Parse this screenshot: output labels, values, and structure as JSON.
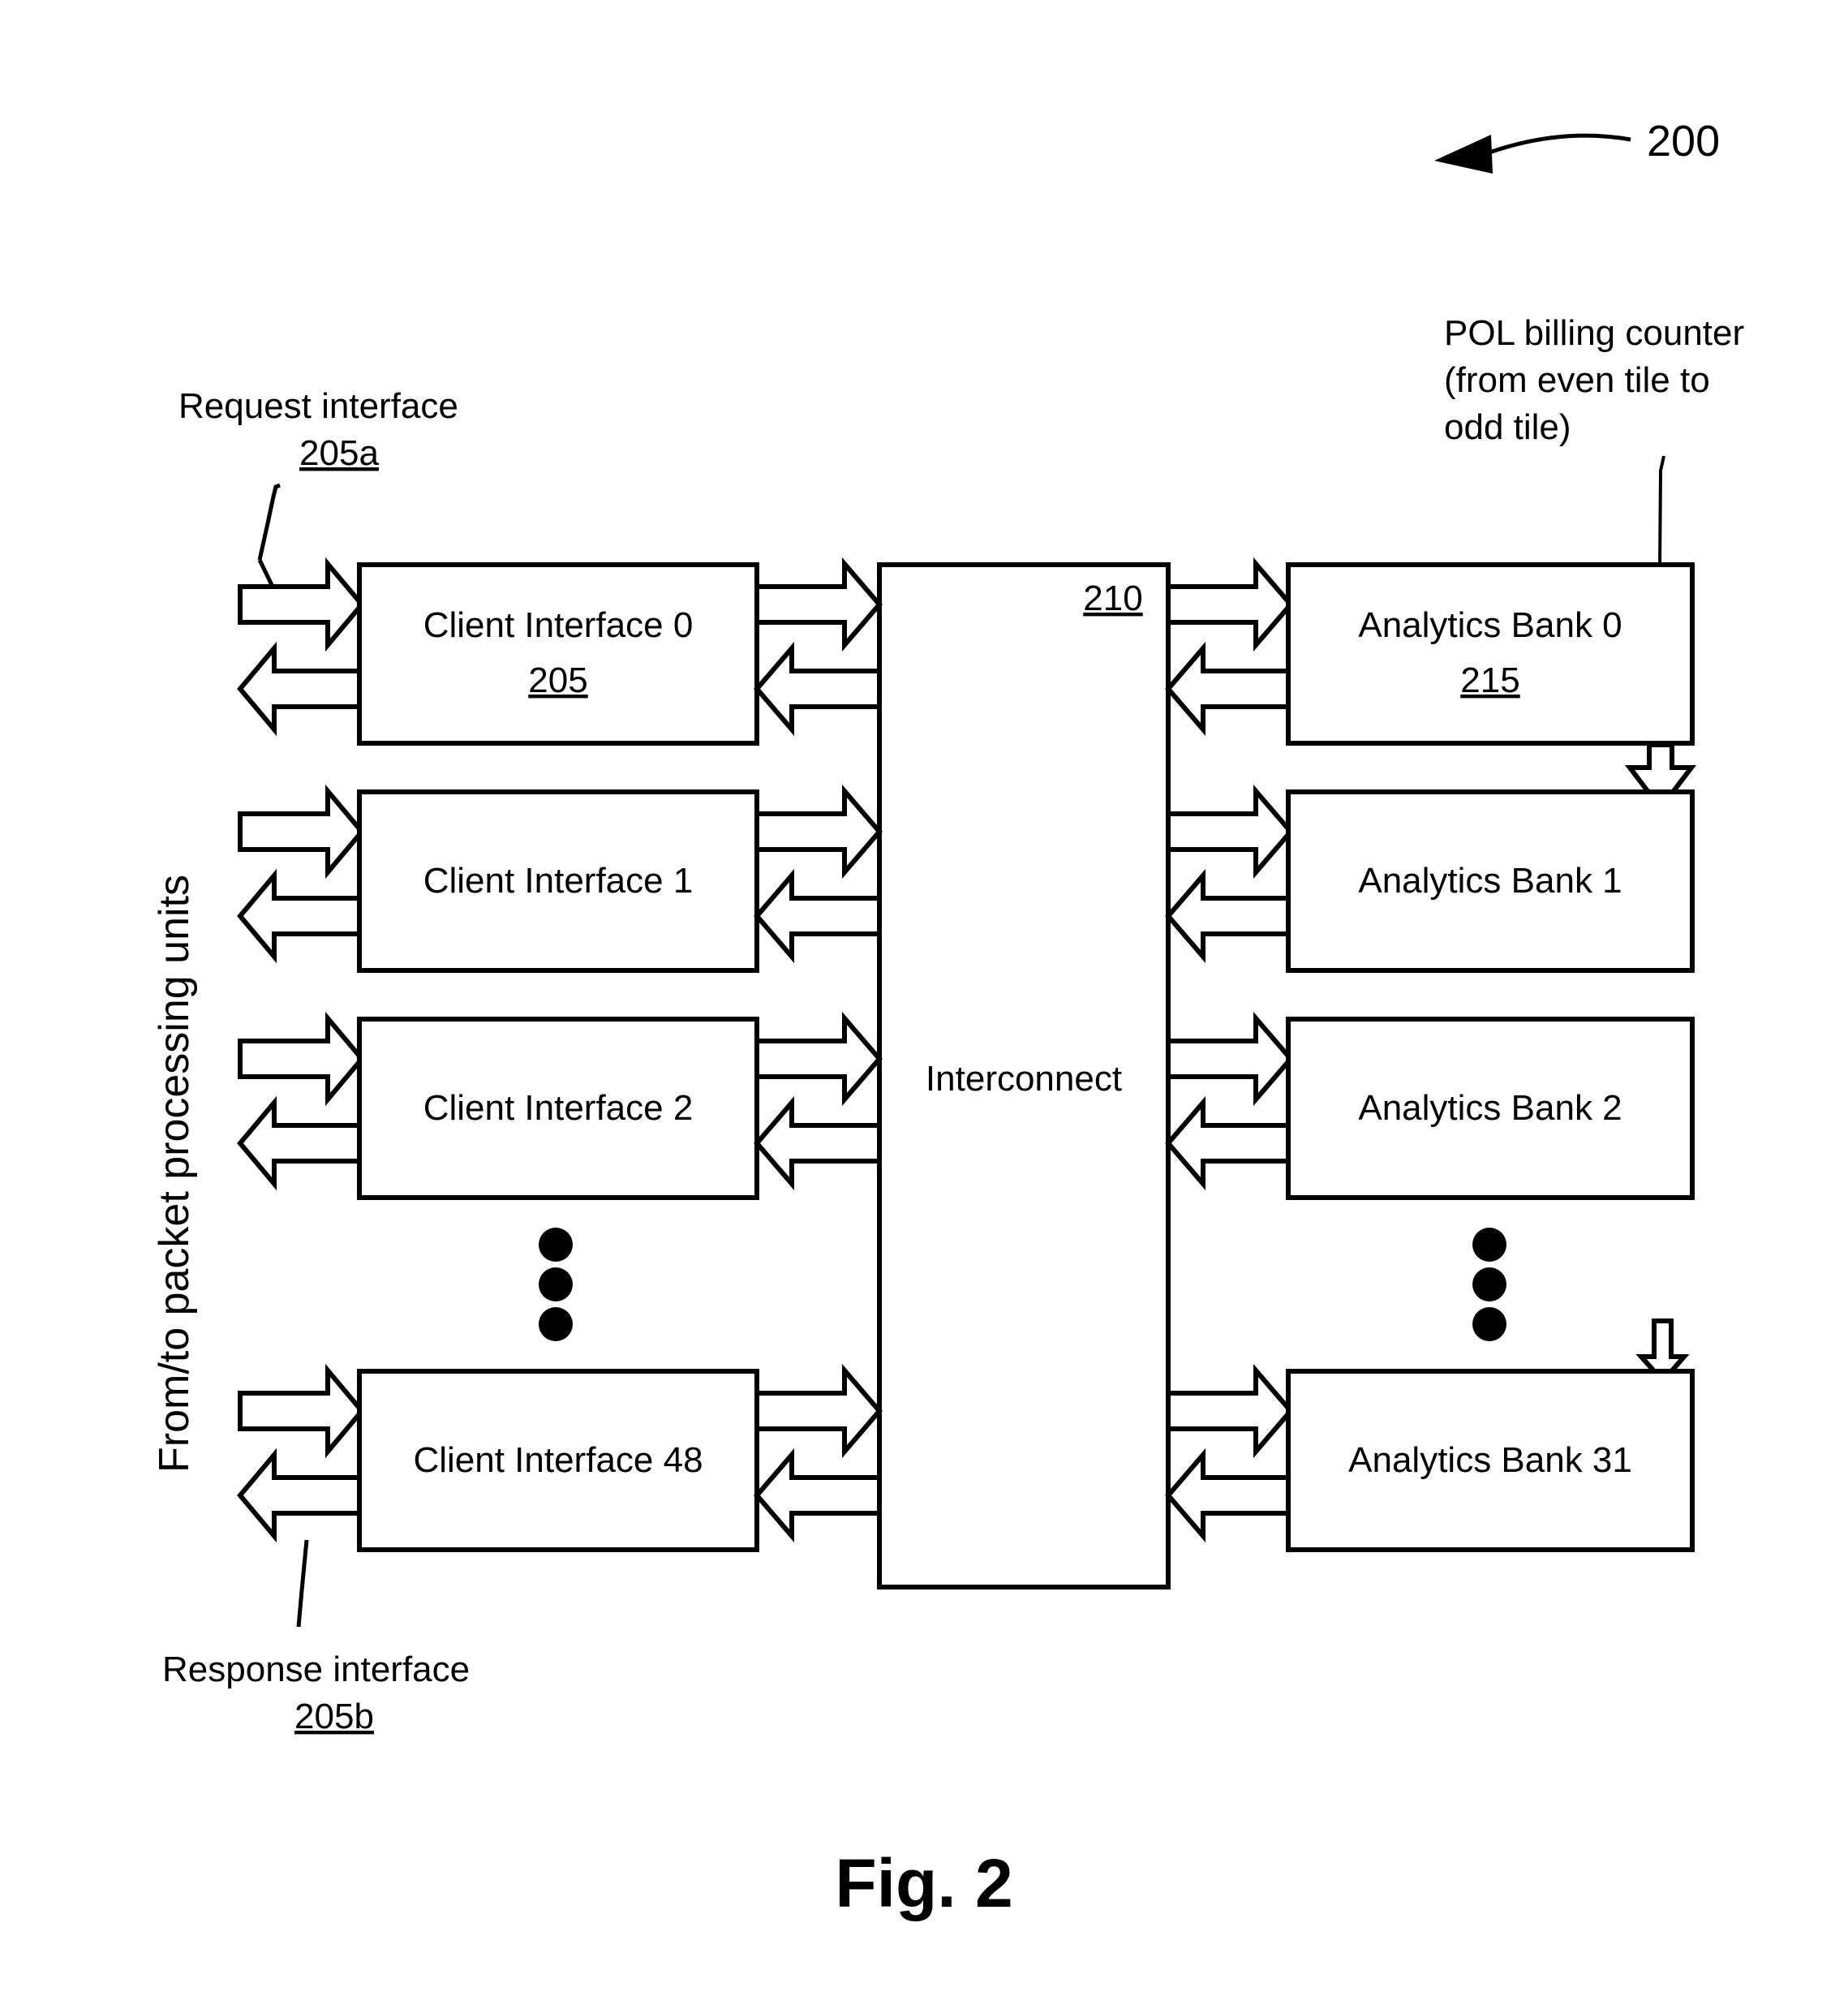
{
  "figure": {
    "number_callout": "200",
    "caption": "Fig. 2"
  },
  "annotations": {
    "request_interface": {
      "label": "Request interface",
      "ref": "205a"
    },
    "response_interface": {
      "label": "Response interface",
      "ref": "205b"
    },
    "side_label": "From/to packet processing units",
    "pol_counter": {
      "line1": "POL billing counter",
      "line2": "(from even tile to",
      "line3": "odd tile)"
    }
  },
  "client_interfaces": [
    {
      "label": "Client Interface 0",
      "ref": "205"
    },
    {
      "label": "Client Interface 1",
      "ref": ""
    },
    {
      "label": "Client Interface 2",
      "ref": ""
    },
    {
      "label": "Client Interface 48",
      "ref": ""
    }
  ],
  "interconnect": {
    "label": "Interconnect",
    "ref": "210"
  },
  "analytics_banks": [
    {
      "label": "Analytics Bank 0",
      "ref": "215"
    },
    {
      "label": "Analytics Bank 1",
      "ref": ""
    },
    {
      "label": "Analytics Bank 2",
      "ref": ""
    },
    {
      "label": "Analytics Bank 31",
      "ref": ""
    }
  ],
  "ellipsis": {
    "left": "vertical-three-dots",
    "right": "vertical-three-dots"
  },
  "colors": {
    "ink": "#000000",
    "paper": "#ffffff"
  }
}
